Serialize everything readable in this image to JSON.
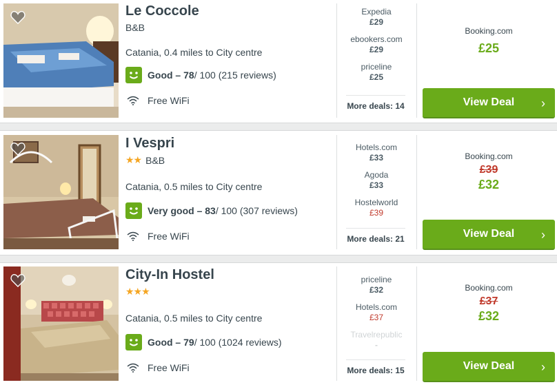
{
  "colors": {
    "accent": "#6aab1a",
    "strike": "#c0392b",
    "star": "#f5a623"
  },
  "hotels": [
    {
      "name": "Le Coccole",
      "stars": "",
      "type": "B&B",
      "location": "Catania, 0.4 miles to City centre",
      "rating_label": "Good – 78",
      "rating_rest": " / 100 (215 reviews)",
      "amenity": "Free WiFi",
      "deals": [
        {
          "site": "Expedia",
          "price": "£29"
        },
        {
          "site": "ebookers.com",
          "price": "£29"
        },
        {
          "site": "priceline",
          "price": "£25"
        }
      ],
      "more_deals": "More deals: 14",
      "best_site": "Booking.com",
      "best_old_price": "",
      "best_price": "£25",
      "button": "View Deal"
    },
    {
      "name": "I Vespri",
      "stars": "★★",
      "type": "B&B",
      "location": "Catania, 0.5 miles to City centre",
      "rating_label": "Very good – 83",
      "rating_rest": " / 100 (307 reviews)",
      "amenity": "Free WiFi",
      "deals": [
        {
          "site": "Hotels.com",
          "price": "£33"
        },
        {
          "site": "Agoda",
          "price": "£33"
        },
        {
          "site": "Hostelworld",
          "price": "£39"
        }
      ],
      "more_deals": "More deals: 21",
      "best_site": "Booking.com",
      "best_old_price": "£39",
      "best_price": "£32",
      "button": "View Deal"
    },
    {
      "name": "City-In Hostel",
      "stars": "★★★",
      "type": "",
      "location": "Catania, 0.5 miles to City centre",
      "rating_label": "Good – 79",
      "rating_rest": " / 100 (1024 reviews)",
      "amenity": "Free WiFi",
      "deals": [
        {
          "site": "priceline",
          "price": "£32"
        },
        {
          "site": "Hotels.com",
          "price": "£37"
        },
        {
          "site": "Travelrepublic",
          "price": "-"
        }
      ],
      "more_deals": "More deals: 15",
      "best_site": "Booking.com",
      "best_old_price": "£37",
      "best_price": "£32",
      "button": "View Deal"
    }
  ]
}
